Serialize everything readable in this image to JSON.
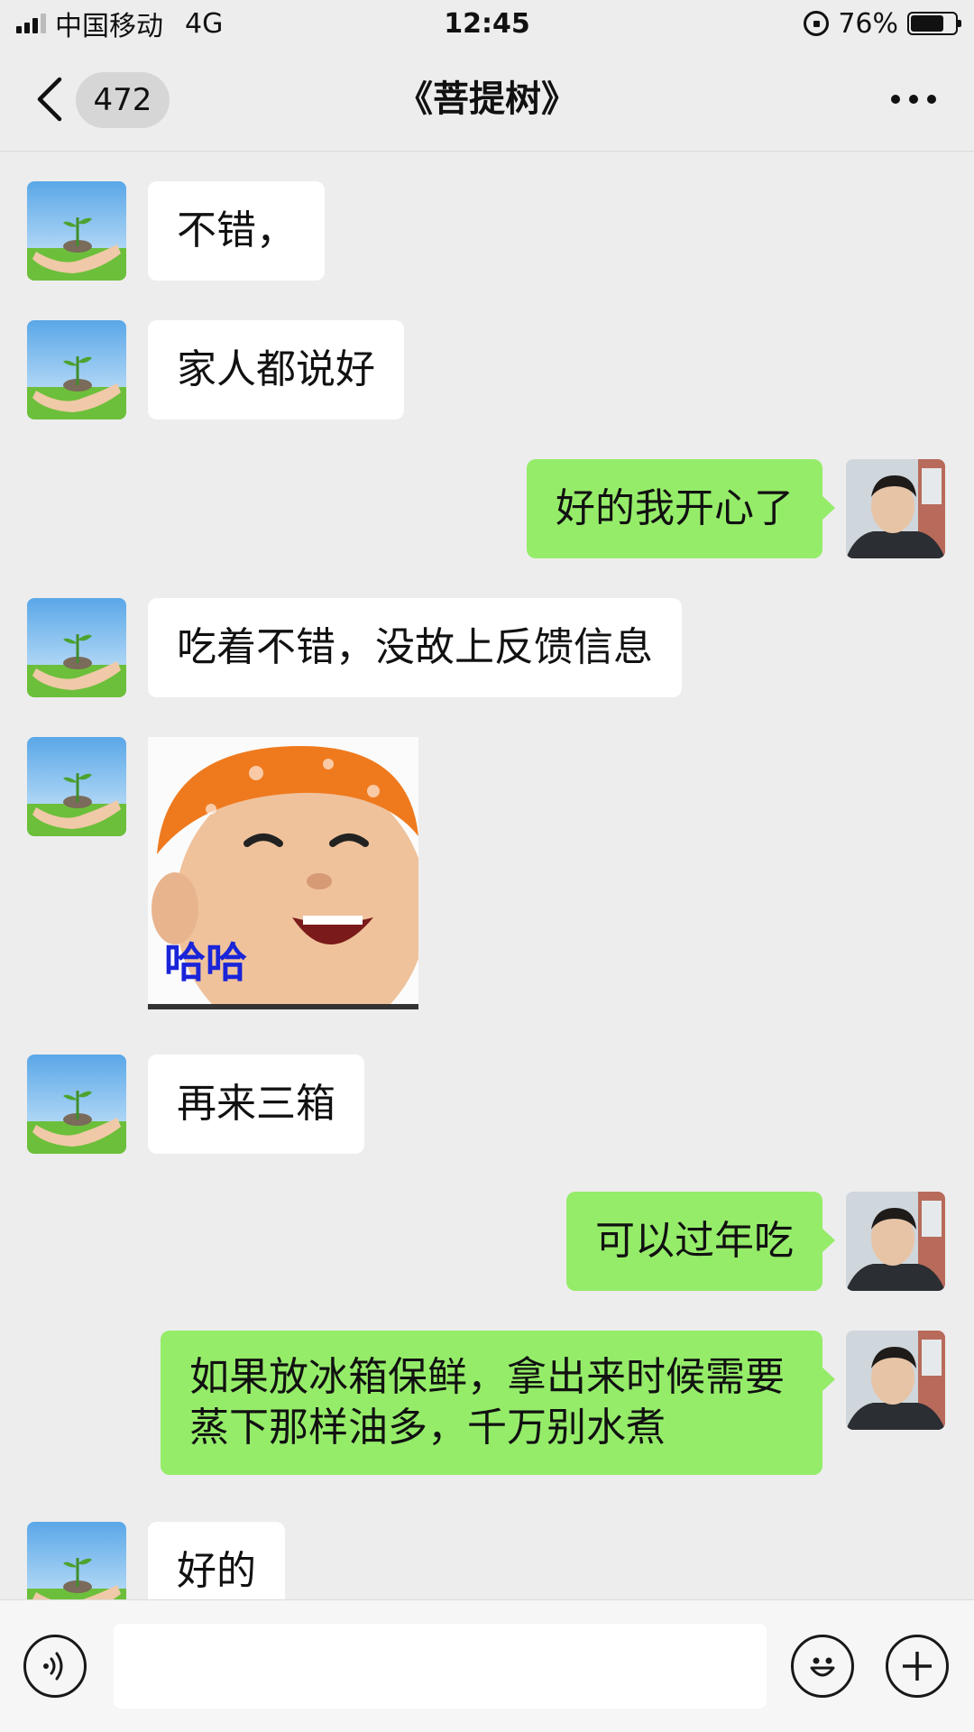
{
  "status_bar": {
    "carrier": "中国移动",
    "network": "4G",
    "time": "12:45",
    "battery": "76%",
    "battery_level": 0.76
  },
  "nav": {
    "unread_count": "472",
    "title": "《菩提树》"
  },
  "messages": [
    {
      "side": "in",
      "text": "不错，"
    },
    {
      "side": "in",
      "text": "家人都说好"
    },
    {
      "side": "out",
      "text": "好的我开心了"
    },
    {
      "side": "in",
      "text": "吃着不错，没故上反馈信息"
    },
    {
      "side": "in",
      "type": "sticker",
      "text": "哈哈"
    },
    {
      "side": "in",
      "text": "再来三箱"
    },
    {
      "side": "out",
      "text": "可以过年吃"
    },
    {
      "side": "out",
      "text": "如果放冰箱保鲜，拿出来时候需要蒸下那样油多，千万别水煮"
    },
    {
      "side": "in",
      "text": "好的"
    }
  ],
  "input": {
    "value": ""
  },
  "icons": {
    "back": "chevron-left-icon",
    "more": "more-dots-icon",
    "voice": "voice-icon",
    "emoji": "emoji-icon",
    "plus": "plus-icon"
  },
  "colors": {
    "background": "#ededed",
    "outgoing_bubble": "#95ec69",
    "incoming_bubble": "#ffffff",
    "sticker_text": "#1a24d8"
  }
}
